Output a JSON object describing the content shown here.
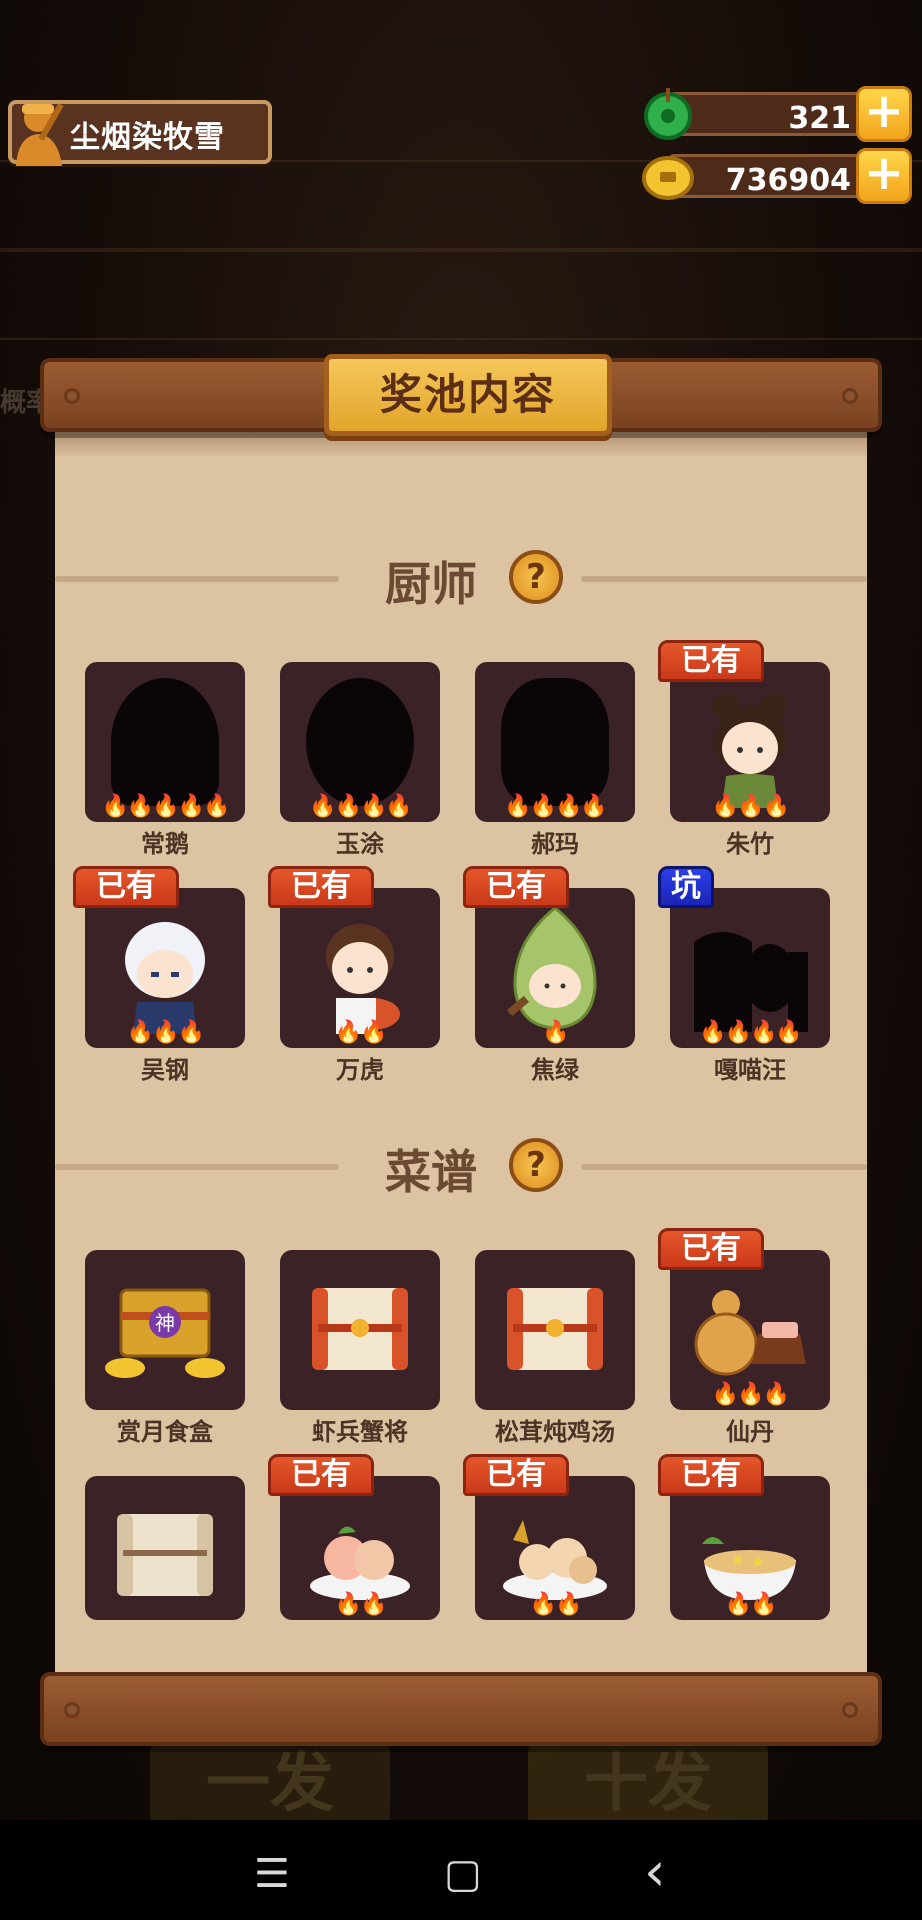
{
  "player": {
    "name": "尘烟染牧雪"
  },
  "resources": {
    "jade": "321",
    "coins": "736904",
    "plus_label": "+"
  },
  "panel": {
    "title": "奖池内容"
  },
  "background": {
    "side_text": "概率",
    "btn_single": "一发",
    "btn_ten": "十发"
  },
  "sections": {
    "chefs": {
      "label": "厨师",
      "help": "?"
    },
    "recipes": {
      "label": "菜谱",
      "help": "?"
    }
  },
  "tags": {
    "owned": "已有",
    "pit": "坑"
  },
  "chefs": [
    {
      "name": "常鹅",
      "stars": "🔥🔥🔥🔥🔥",
      "owned": false
    },
    {
      "name": "玉涂",
      "stars": "🔥🔥🔥🔥",
      "owned": false
    },
    {
      "name": "郝玛",
      "stars": "🔥🔥🔥🔥",
      "owned": false
    },
    {
      "name": "朱竹",
      "stars": "🔥🔥🔥",
      "owned": true
    },
    {
      "name": "吴钢",
      "stars": "🔥🔥🔥",
      "owned": true
    },
    {
      "name": "万虎",
      "stars": "🔥🔥",
      "owned": true
    },
    {
      "name": "焦绿",
      "stars": "🔥",
      "owned": true
    },
    {
      "name": "嘎喵汪",
      "stars": "🔥🔥🔥🔥",
      "owned": false,
      "pit": true
    }
  ],
  "recipes": [
    {
      "name": "赏月食盒",
      "stars": "",
      "owned": false,
      "badge": "神"
    },
    {
      "name": "虾兵蟹将",
      "stars": "",
      "owned": false
    },
    {
      "name": "松茸炖鸡汤",
      "stars": "",
      "owned": false
    },
    {
      "name": "仙丹",
      "stars": "🔥🔥🔥",
      "owned": true
    },
    {
      "name": "",
      "stars": "",
      "owned": false
    },
    {
      "name": "",
      "stars": "🔥🔥",
      "owned": true
    },
    {
      "name": "",
      "stars": "🔥🔥",
      "owned": true
    },
    {
      "name": "",
      "stars": "🔥🔥",
      "owned": true
    }
  ],
  "nav": {
    "menu_icon": "☰",
    "home_icon": "▢",
    "back_icon": "‹"
  },
  "colors": {
    "owned_tag": "#d8462a",
    "pit_tag": "#2232d0",
    "card_bg": "#3b2226",
    "panel_bg": "#dcc3a1"
  }
}
